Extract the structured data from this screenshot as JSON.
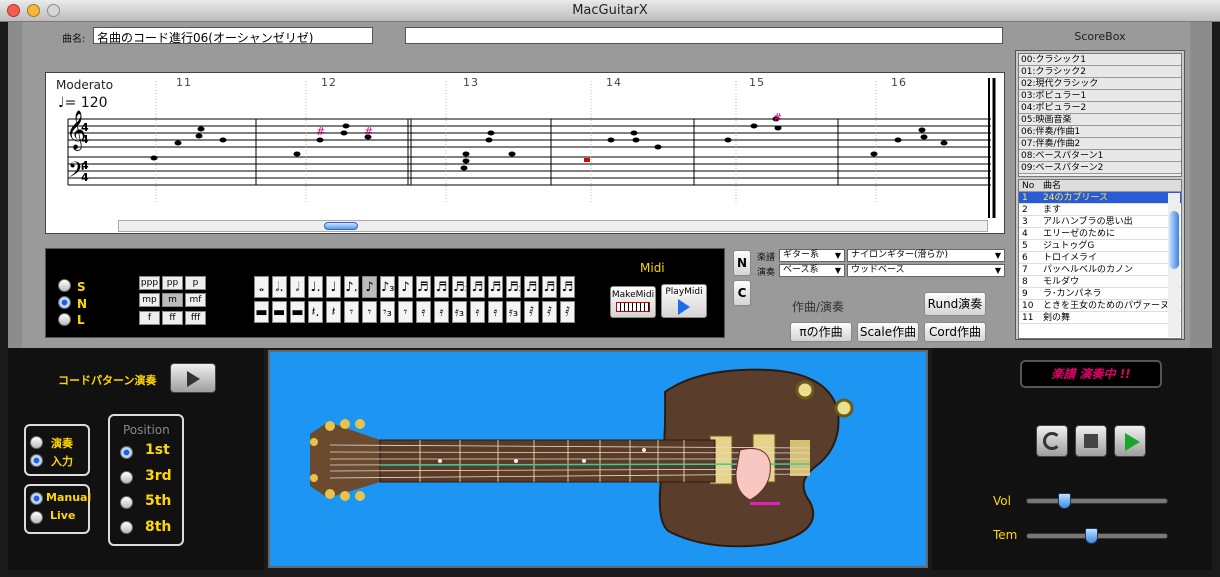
{
  "window": {
    "title": "MacGuitarX"
  },
  "song": {
    "label": "曲名:",
    "name": "名曲のコード進行06(オーシャンゼリゼ)"
  },
  "score": {
    "tempo_mark": "Moderato",
    "bpm": "♩= 120",
    "measures": [
      "11",
      "12",
      "13",
      "14",
      "15",
      "16"
    ],
    "beats": [
      "1",
      "2",
      "3",
      "4"
    ]
  },
  "scorebox": {
    "title": "ScoreBox",
    "categories": [
      "00:クラシック1",
      "01:クラシック2",
      "02:現代クラシック",
      "03:ポピュラー1",
      "04:ポピュラー2",
      "05:映画音楽",
      "06:伴奏/作曲1",
      "07:伴奏/作曲2",
      "08:ベースパターン1",
      "09:ベースパターン2"
    ],
    "col_no": "No",
    "col_name": "曲名",
    "songs": [
      {
        "no": "1",
        "name": "24のカプリース"
      },
      {
        "no": "2",
        "name": "ます"
      },
      {
        "no": "3",
        "name": "アルハンブラの思い出"
      },
      {
        "no": "4",
        "name": "エリーゼのために"
      },
      {
        "no": "5",
        "name": "ジュトゥグG"
      },
      {
        "no": "6",
        "name": "トロイメライ"
      },
      {
        "no": "7",
        "name": "パッヘルベルのカノン"
      },
      {
        "no": "8",
        "name": "モルダウ"
      },
      {
        "no": "9",
        "name": "ラ･カンパネラ"
      },
      {
        "no": "10",
        "name": "ときを王女のためのパヴァーヌ"
      },
      {
        "no": "11",
        "name": "剣の舞"
      }
    ]
  },
  "modes": {
    "s": "S",
    "n": "N",
    "l": "L"
  },
  "dynamics": [
    "ppp",
    "pp",
    "p",
    "mp",
    "m",
    "mf",
    "f",
    "ff",
    "fff"
  ],
  "midi": {
    "title": "Midi",
    "make": "MakeMidi",
    "play": "PlayMidi"
  },
  "nc": {
    "n": "N",
    "c": "C"
  },
  "instruments": {
    "score_label": "楽譜",
    "score_type": "ギター系",
    "score_instrument": "ナイロンギター(滑らか)",
    "play_label": "演奏",
    "play_type": "ベース系",
    "play_instrument": "ウッドベース"
  },
  "compose": {
    "title": "作曲/演奏",
    "rund": "Rund演奏",
    "pi": "πの作曲",
    "scale": "Scale作曲",
    "cord": "Cord作曲"
  },
  "left_panel": {
    "chord_pattern": "コードパターン演奏",
    "play": "演奏",
    "input": "入力",
    "manual": "Manual",
    "live": "Live",
    "position_title": "Position",
    "positions": [
      "1st",
      "3rd",
      "5th",
      "8th"
    ]
  },
  "right_panel": {
    "status": "楽譜 演奏中 !!",
    "vol": "Vol",
    "tem": "Tem",
    "vol_value": 0.25,
    "tem_value": 0.46
  },
  "colors": {
    "status_text": "#e0006a",
    "guitar_bg": "#1d95f2",
    "selected_row": "#2a5bd6"
  }
}
